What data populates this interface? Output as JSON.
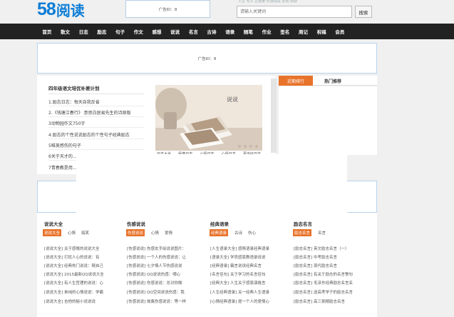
{
  "logo": {
    "num": "58",
    "text": "阅读"
  },
  "top_ad": "广告ID：8",
  "hot_links": "人生 句子 正能量 伤感说说 爱情 情感",
  "search": {
    "placeholder": "请输入关键词",
    "button": "搜索"
  },
  "nav": [
    "首页",
    "散文",
    "日志",
    "励志",
    "句子",
    "作文",
    "感想",
    "说说",
    "名言",
    "古诗",
    "语录",
    "随笔",
    "作业",
    "签名",
    "周记",
    "祝福",
    "会员"
  ],
  "main_ad": "广告ID：8",
  "left_list": {
    "title": "四年级语文培优补差计划",
    "items": [
      "1.励志日志：每天自我反省",
      "2.《钱塘江春行》 意思白居易先生的诗原版",
      "3动物园作文750字",
      "4.励志的个性说说励志的个性句子经典励志",
      "5唯美感伤的句子",
      "6关于天才的...",
      "7青春教是用..."
    ]
  },
  "photo": {
    "label": "说说",
    "captions": [
      "日志大全",
      "经典日志",
      "心情日志",
      "心情日志",
      "更多好日志"
    ]
  },
  "right_tabs": {
    "active": "近期排行",
    "other": "热门推荐"
  },
  "categories": [
    {
      "title": "说说大全",
      "tags": [
        "说说大全",
        "心情",
        "搞笑"
      ],
      "items": [
        "[说说大全] 关于感慨的说说大全",
        "[说说大全] 打扰人心的说说：有",
        "[说说大全] 经典热门说说：随自己",
        "[说说大全] 2015最新QQ说说大全",
        "[说说大全] 有人生哲理的说说：心",
        "[说说大全] 单纯的心情说说：学霸",
        "[说说大全] 吉他的秘小说说说"
      ]
    },
    {
      "title": "伤感说说",
      "tags": [
        "伤感说说",
        "心情",
        "爱情"
      ],
      "items": [
        "[伤感说说] 伤感女手绘说说图片：",
        "[伤感说说] 一个人的伤感说说：让",
        "[伤感说说] 七夕情人节伤感说说",
        "[伤感说说] QQ说说伤感：哪心",
        "[伤感说说] 伤感说说：总对你微",
        "[伤感说说] QQ空间说说伤感：我",
        "[伤感说说] 故离伤感说说：等一样"
      ]
    },
    {
      "title": "经典语录",
      "tags": [
        "经典语录",
        "古诗",
        "伤心"
      ],
      "items": [
        "[人生语录大全] 感情语录经典语录",
        "[语录大全] 学员感恩教语录说说",
        "[经典语录] 霸言说说经典名言",
        "[名言佳句] 关于学习的名言佳句",
        "[经典大全] 人生关于感恩演格言",
        "[人生经典语录] 关一经典人生语录",
        "[心情经典语录] 提一个人的爱情心"
      ]
    },
    {
      "title": "励志名言",
      "tags": [
        "励志名言",
        "名言"
      ],
      "items": [
        "[励志名言] 英文励志名言（一）",
        "[励志名言] 中考励志名言",
        "[励志名言] 现代励志名言",
        "[励志名言] 有关于励志的名言警句",
        "[励志名言] 毛泽东经典励志名言名",
        "[励志名言] 送高考学子的励志名言",
        "[励志名言] 高三挑精励志名言"
      ]
    }
  ]
}
